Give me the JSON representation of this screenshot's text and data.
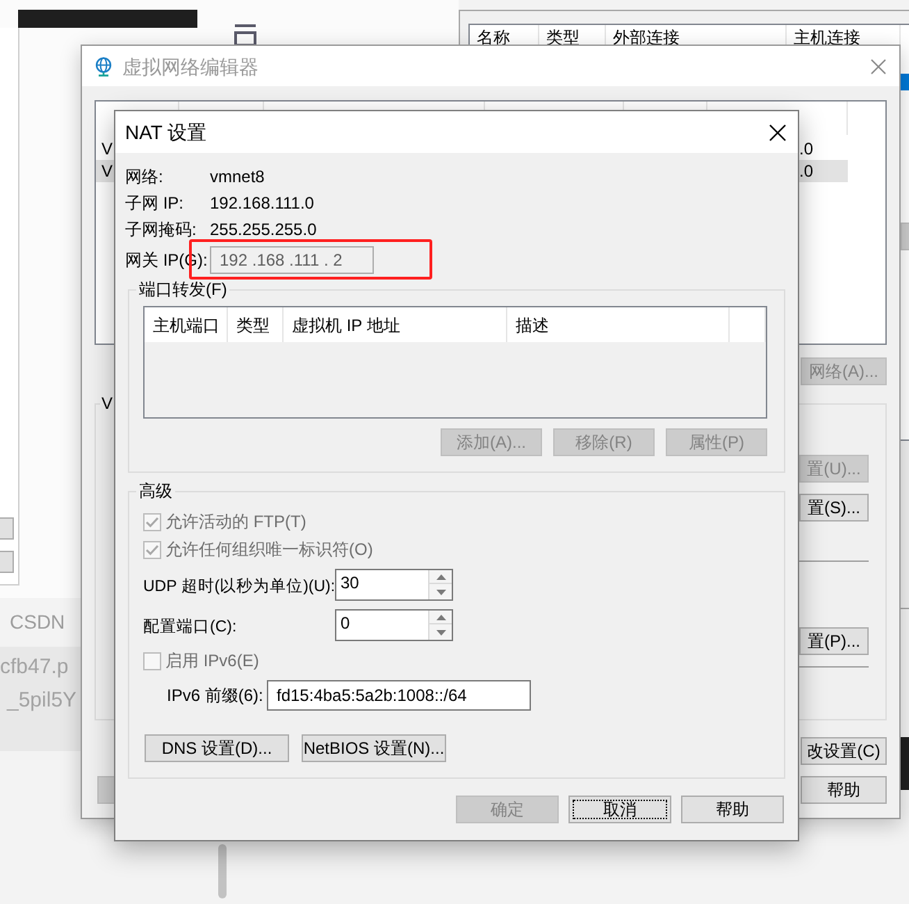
{
  "behind_windows": {
    "label": "CSDN",
    "list_lines": [
      "cfb47.p",
      "_5pil5Y"
    ]
  },
  "host_window": {
    "columns": [
      "名称",
      "类型",
      "外部连接",
      "主机连接"
    ]
  },
  "editor_window": {
    "title": "虚拟网络编辑器",
    "active": false,
    "rows": [
      {
        "column_1": "V",
        "column_6": ".0",
        "selected": false
      },
      {
        "column_1": "V",
        "column_6": ".0",
        "selected": true
      }
    ],
    "list_button": {
      "label": "网络(A)...",
      "disabled": true
    },
    "group_label": "V",
    "group_buttons": [
      {
        "label": "置(U)...",
        "disabled": true
      },
      {
        "label": "置(S)...",
        "disabled": false
      },
      {
        "label": "置(P)...",
        "disabled": false
      }
    ],
    "buttons": [
      {
        "label": "改设置(C)",
        "disabled": false
      },
      {
        "label": "帮助",
        "disabled": false
      }
    ]
  },
  "nat_dialog": {
    "title": "NAT 设置",
    "info": [
      {
        "label": "网络:",
        "value": "vmnet8"
      },
      {
        "label": "子网 IP:",
        "value": "192.168.111.0"
      },
      {
        "label": "子网掩码:",
        "value": "255.255.255.0"
      }
    ],
    "gateway": {
      "label": "网关 IP(G):",
      "value": "192 .168 .111 . 2",
      "disabled": true
    },
    "annotation": {
      "kind": "rectangle"
    },
    "port_forwarding": {
      "title": "端口转发(F)",
      "columns": [
        "主机端口",
        "类型",
        "虚拟机 IP 地址",
        "描述"
      ],
      "buttons": [
        {
          "label": "添加(A)...",
          "disabled": true
        },
        {
          "label": "移除(R)",
          "disabled": true
        },
        {
          "label": "属性(P)",
          "disabled": true
        }
      ]
    },
    "advanced": {
      "title": "高级",
      "options": [
        {
          "kind": "checkbox",
          "label": "允许活动的 FTP(T)",
          "checked": true,
          "disabled": true
        },
        {
          "kind": "checkbox",
          "label": "允许任何组织唯一标识符(O)",
          "checked": true,
          "disabled": true
        },
        {
          "kind": "spinner",
          "label": "UDP 超时(以秒为单位)(U):",
          "value": "30"
        },
        {
          "kind": "spinner",
          "label": "配置端口(C):",
          "value": "0"
        },
        {
          "kind": "checkbox",
          "label": "启用 IPv6(E)",
          "checked": false,
          "disabled": true
        },
        {
          "kind": "text",
          "label": "IPv6 前缀(6):",
          "value": "fd15:4ba5:5a2b:1008::/64"
        }
      ],
      "buttons": [
        {
          "label": "DNS 设置(D)...",
          "disabled": false
        },
        {
          "label": "NetBIOS 设置(N)...",
          "disabled": false
        }
      ]
    },
    "buttons": [
      {
        "label": "确定",
        "disabled": true,
        "focused": false
      },
      {
        "label": "取消",
        "disabled": false,
        "focused": true
      },
      {
        "label": "帮助",
        "disabled": false,
        "focused": false
      }
    ]
  }
}
